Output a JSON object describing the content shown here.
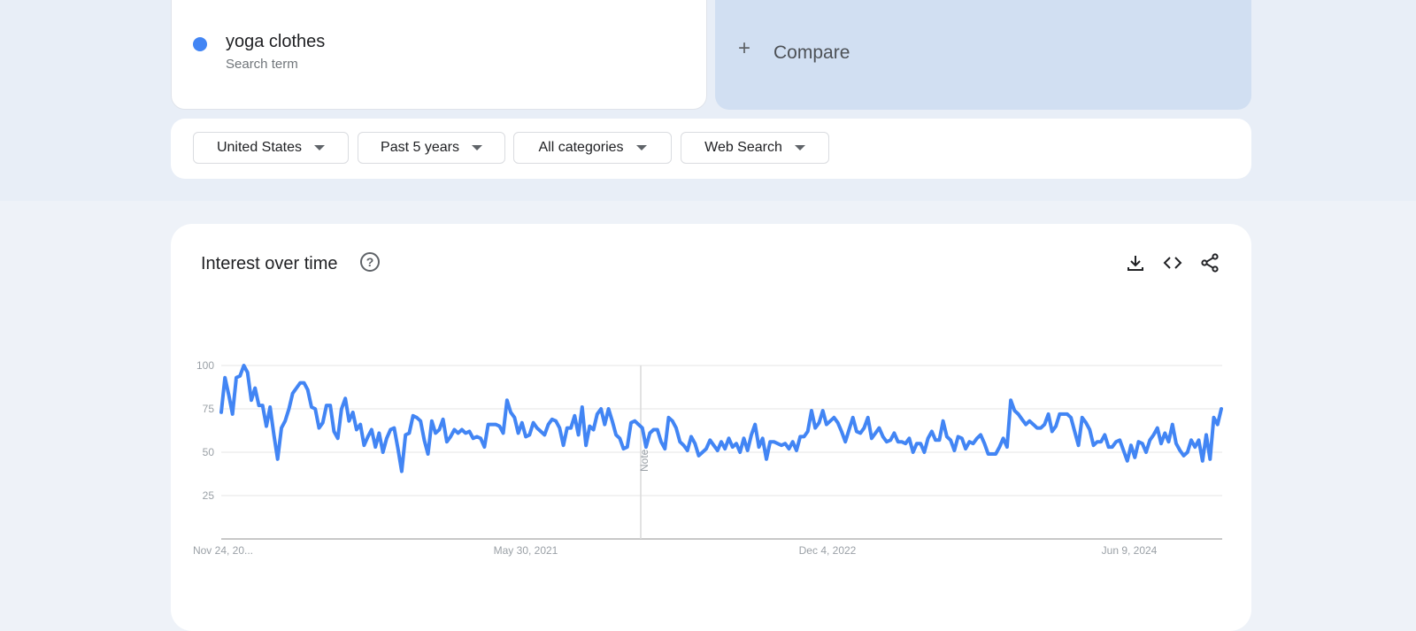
{
  "term": {
    "name": "yoga clothes",
    "subtitle": "Search term",
    "color": "#4285f4"
  },
  "compare": {
    "label": "Compare"
  },
  "filters": [
    {
      "label": "United States"
    },
    {
      "label": "Past 5 years"
    },
    {
      "label": "All categories"
    },
    {
      "label": "Web Search"
    }
  ],
  "chart_card": {
    "title": "Interest over time",
    "help_icon": "help-circle-icon",
    "actions": [
      "download-icon",
      "embed-code-icon",
      "share-icon"
    ]
  },
  "chart_data": {
    "type": "line",
    "title": "",
    "xlabel": "",
    "ylabel": "",
    "ylim": [
      0,
      100
    ],
    "yticks": [
      25,
      50,
      75,
      100
    ],
    "xtick_labels": [
      "Nov 24, 20...",
      "May 30, 2021",
      "Dec 4, 2022",
      "Jun 9, 2024"
    ],
    "note_label": "Note",
    "grid": true,
    "legend": "none",
    "series": [
      {
        "color": "#4285f4",
        "values": [
          73,
          93,
          83,
          72,
          93,
          94,
          100,
          96,
          80,
          87,
          77,
          77,
          65,
          76,
          60,
          46,
          64,
          68,
          75,
          84,
          87,
          90,
          90,
          86,
          76,
          75,
          64,
          67,
          77,
          77,
          62,
          58,
          75,
          81,
          68,
          73,
          63,
          66,
          54,
          59,
          63,
          53,
          61,
          50,
          58,
          63,
          64,
          52,
          39,
          60,
          61,
          71,
          70,
          68,
          57,
          49,
          68,
          61,
          63,
          69,
          56,
          59,
          63,
          61,
          63,
          61,
          62,
          58,
          59,
          58,
          53,
          66,
          66,
          66,
          65,
          61,
          80,
          73,
          70,
          61,
          67,
          59,
          60,
          67,
          64,
          62,
          60,
          66,
          69,
          68,
          64,
          54,
          64,
          64,
          71,
          60,
          76,
          54,
          65,
          63,
          72,
          75,
          66,
          75,
          68,
          60,
          58,
          52,
          53,
          67,
          68,
          66,
          64,
          53,
          61,
          63,
          63,
          56,
          52,
          70,
          68,
          64,
          56,
          54,
          51,
          59,
          55,
          48,
          50,
          52,
          57,
          54,
          51,
          56,
          52,
          58,
          53,
          55,
          50,
          58,
          51,
          60,
          66,
          53,
          58,
          46,
          56,
          56,
          55,
          54,
          55,
          52,
          56,
          51,
          59,
          59,
          62,
          74,
          64,
          67,
          74,
          66,
          68,
          70,
          67,
          62,
          56,
          63,
          70,
          62,
          61,
          64,
          70,
          58,
          61,
          64,
          59,
          56,
          57,
          61,
          56,
          56,
          55,
          58,
          50,
          55,
          55,
          50,
          58,
          62,
          57,
          57,
          68,
          59,
          57,
          51,
          59,
          58,
          52,
          56,
          55,
          58,
          60,
          55,
          49,
          49,
          49,
          53,
          58,
          53,
          80,
          74,
          72,
          69,
          66,
          68,
          66,
          64,
          64,
          66,
          72,
          62,
          65,
          72,
          72,
          72,
          70,
          62,
          54,
          70,
          67,
          63,
          54,
          56,
          56,
          60,
          53,
          53,
          56,
          57,
          51,
          45,
          54,
          47,
          56,
          55,
          50,
          57,
          60,
          64,
          55,
          61,
          56,
          66,
          55,
          51,
          48,
          50,
          57,
          53,
          57,
          45,
          60,
          46,
          70,
          66,
          75
        ]
      }
    ]
  }
}
